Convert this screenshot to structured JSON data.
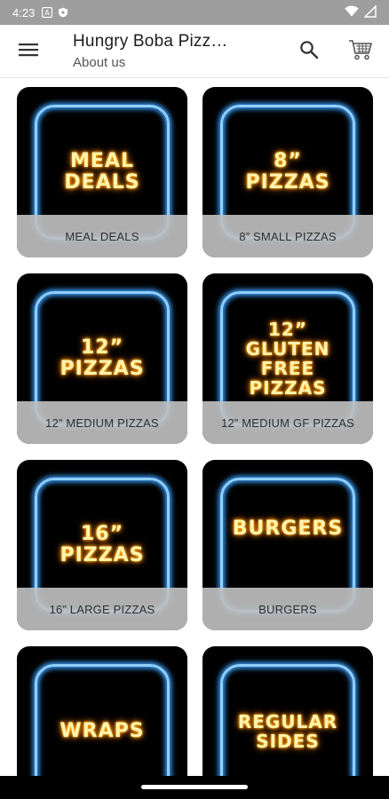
{
  "status_bar": {
    "time": "4:23",
    "notification_icons": [
      "a-icon",
      "shield-icon"
    ],
    "system_icons": [
      "wifi-icon",
      "signal-icon"
    ]
  },
  "app_bar": {
    "title": "Hungry Boba Pizz…",
    "subtitle": "About us",
    "icons": [
      "menu-icon",
      "search-icon",
      "cart-icon"
    ]
  },
  "categories": [
    {
      "image_text": "MEAL\nDEALS",
      "label": "MEAL DEALS"
    },
    {
      "image_text": "8”\nPIZZAS",
      "label": "8” SMALL PIZZAS"
    },
    {
      "image_text": "12”\nPIZZAS",
      "label": "12” MEDIUM PIZZAS"
    },
    {
      "image_text": "12”\nGLUTEN\nFREE\nPIZZAS",
      "label": "12” MEDIUM GF PIZZAS"
    },
    {
      "image_text": "16”\nPIZZAS",
      "label": "16” LARGE PIZZAS"
    },
    {
      "image_text": "BURGERS",
      "label": "BURGERS"
    },
    {
      "image_text": "WRAPS",
      "label": ""
    },
    {
      "image_text": "REGULAR\nSIDES",
      "label": ""
    }
  ],
  "colors": {
    "status_bar": "#9e9e9e",
    "tile_background": "#000000",
    "neon_frame": "#8fd0ff",
    "neon_text": "#ffb000",
    "caption_background": "#bebebe"
  }
}
